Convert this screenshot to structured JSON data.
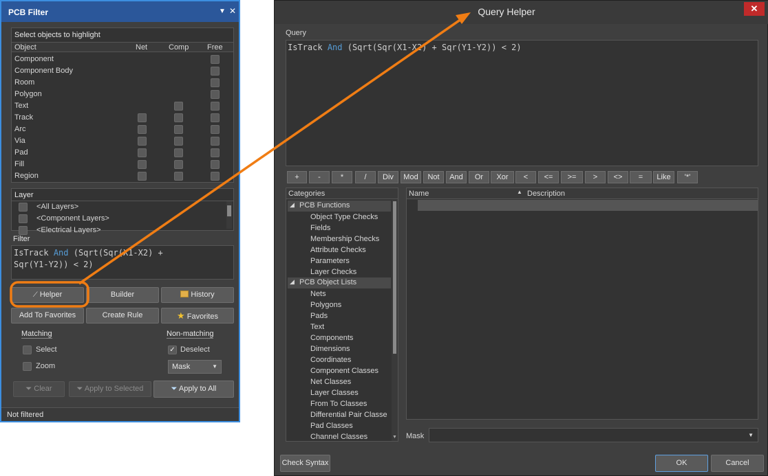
{
  "pcb_filter": {
    "title": "PCB Filter",
    "objects_header": "Select objects to highlight",
    "columns": [
      "Object",
      "Net",
      "Comp",
      "Free"
    ],
    "objects": [
      "Component",
      "Component Body",
      "Room",
      "Polygon",
      "Text",
      "Track",
      "Arc",
      "Via",
      "Pad",
      "Fill",
      "Region"
    ],
    "layer_header": "Layer",
    "layers": [
      "<All Layers>",
      "<Component Layers>",
      "<Electrical Layers>"
    ],
    "filter_label": "Filter",
    "filter_line1_a": "IsTrack",
    "filter_line1_kw": "And",
    "filter_line1_b": "(Sqrt(Sqr(X1-X2) +",
    "filter_line2": "Sqr(Y1-Y2)) < 2)",
    "buttons": {
      "helper": "Helper",
      "builder": "Builder",
      "history": "History",
      "add_favorites": "Add To Favorites",
      "create_rule": "Create Rule",
      "favorites": "Favorites",
      "clear": "Clear",
      "apply_selected": "Apply to Selected",
      "apply_all": "Apply to All"
    },
    "matching": "Matching",
    "select": "Select",
    "zoom": "Zoom",
    "non_matching": "Non-matching",
    "deselect": "Deselect",
    "mask": "Mask",
    "status": "Not filtered"
  },
  "query_helper": {
    "title": "Query Helper",
    "query_label": "Query",
    "query_a": "IsTrack",
    "query_kw": "And",
    "query_b": "(Sqrt(Sqr(X1-X2) + Sqr(Y1-Y2)) < 2)",
    "operators": [
      "+",
      "-",
      "*",
      "/",
      "Div",
      "Mod",
      "Not",
      "And",
      "Or",
      "Xor",
      "<",
      "<=",
      ">=",
      ">",
      "<>",
      "=",
      "Like",
      "'*'"
    ],
    "categories_header": "Categories",
    "pcb_functions": "PCB Functions",
    "function_items": [
      "Object Type Checks",
      "Fields",
      "Membership Checks",
      "Attribute Checks",
      "Parameters",
      "Layer Checks"
    ],
    "pcb_object_lists": "PCB Object Lists",
    "list_items": [
      "Nets",
      "Polygons",
      "Pads",
      "Text",
      "Components",
      "Dimensions",
      "Coordinates",
      "Component Classes",
      "Net Classes",
      "Layer Classes",
      "From To Classes",
      "Differential Pair Classe",
      "Pad Classes",
      "Channel Classes"
    ],
    "name_col": "Name",
    "desc_col": "Description",
    "mask_label": "Mask",
    "check_syntax": "Check Syntax",
    "ok": "OK",
    "cancel": "Cancel"
  },
  "colors": {
    "accent": "#3c8ee0",
    "annotation": "#f07d14",
    "keyword": "#569cd6",
    "close": "#c02a2a"
  }
}
